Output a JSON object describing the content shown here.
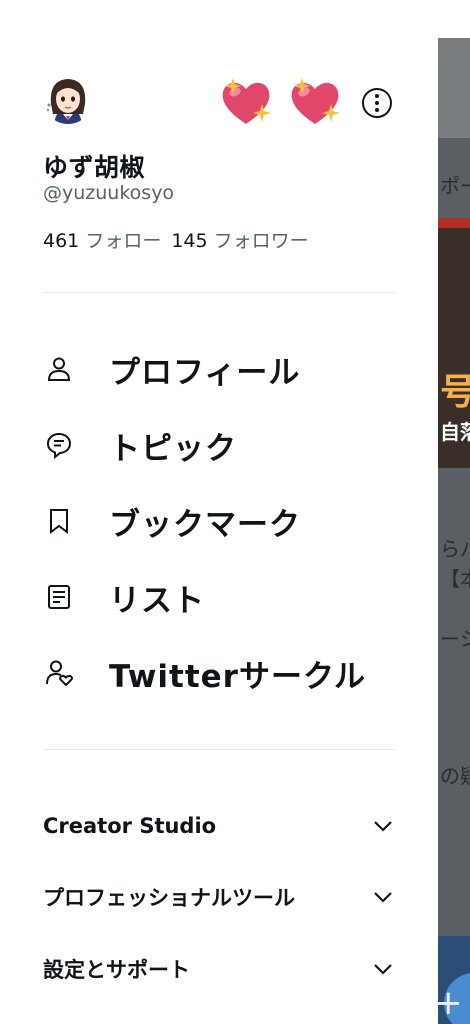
{
  "background_timeline": {
    "line1": "ポー",
    "media_line1": "号の",
    "media_line2": "自落",
    "text1": "らパ",
    "text2": "【本",
    "text3": "ーシ",
    "text4": "の疑",
    "fab_symbol": "+"
  },
  "profile": {
    "display_name": "ゆず胡椒",
    "handle": "@yuzuukosyo",
    "following_count": "461",
    "following_label": "フォロー",
    "followers_count": "145",
    "followers_label": "フォロワー",
    "name_emojis": [
      "sparkling-heart",
      "sparkling-heart"
    ]
  },
  "nav": {
    "items": [
      {
        "label": "プロフィール",
        "icon": "person-icon"
      },
      {
        "label": "トピック",
        "icon": "topics-icon"
      },
      {
        "label": "ブックマーク",
        "icon": "bookmark-icon"
      },
      {
        "label": "リスト",
        "icon": "lists-icon"
      },
      {
        "label": "Twitterサークル",
        "icon": "circle-icon"
      }
    ]
  },
  "sections": [
    {
      "label": "Creator Studio"
    },
    {
      "label": "プロフェッショナルツール"
    },
    {
      "label": "設定とサポート"
    }
  ],
  "colors": {
    "text_primary": "#0f1419",
    "text_secondary": "#536471",
    "divider": "#e6e9eb",
    "heart": "#e0476a",
    "sparkle": "#f6c244"
  }
}
